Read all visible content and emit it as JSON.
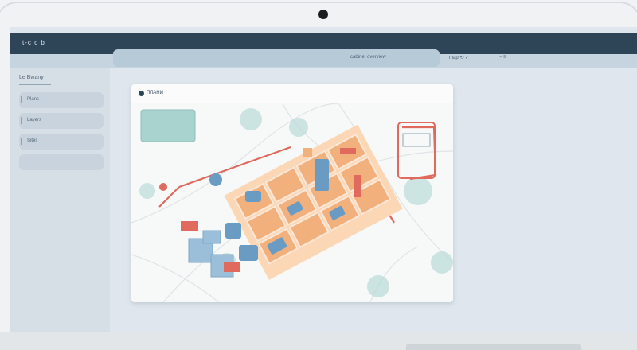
{
  "window": {
    "brand": "t-c c b"
  },
  "topbar": {
    "search_text": "cabinet overview",
    "right_text_1": "map  ⟲  ✓",
    "right_text_2": "≈  ≡"
  },
  "sidebar": {
    "heading": "Le Bwany",
    "items": [
      {
        "label": "Plans",
        "mark": ""
      },
      {
        "label": "Layers",
        "mark": ""
      },
      {
        "label": "Sites",
        "mark": "≈≈≈"
      },
      {
        "label": "",
        "mark": ""
      }
    ]
  },
  "map_card": {
    "title": "ПЛАНИ"
  },
  "colors": {
    "accent_dark": "#2e4558",
    "block_orange": "#f2b07d",
    "block_blue": "#6a9bc3",
    "marker_red": "#e06a5d",
    "park_teal": "#a9d3cf"
  }
}
